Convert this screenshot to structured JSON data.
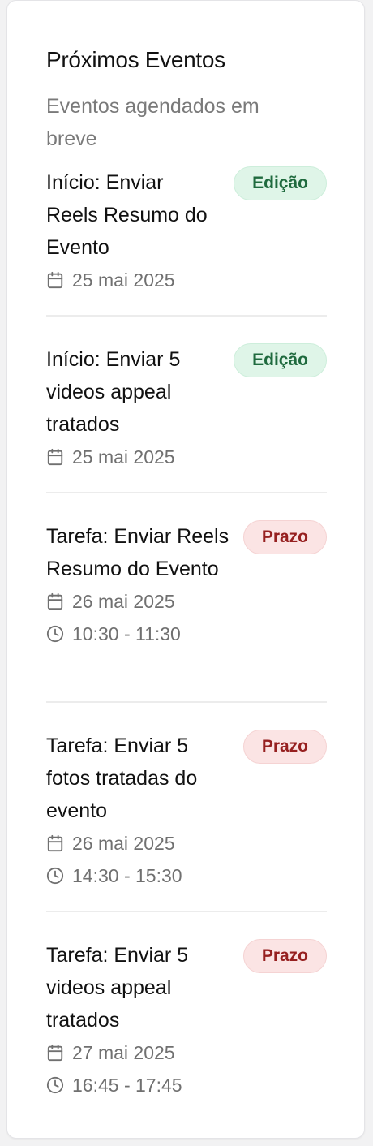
{
  "header": {
    "title": "Próximos Eventos",
    "subtitle": "Eventos agendados em breve"
  },
  "colors": {
    "edicao_bg": "#dff5e8",
    "edicao_text": "#1f6a3e",
    "prazo_bg": "#fbe4e4",
    "prazo_text": "#962020"
  },
  "events": [
    {
      "title": "Início: Enviar Reels Resumo do Evento",
      "badge": "Edição",
      "date": "25 mai 2025",
      "icons": [
        "calendar-icon"
      ]
    },
    {
      "title": "Início: Enviar 5 videos appeal tratados",
      "badge": "Edição",
      "date": "25 mai 2025",
      "icons": [
        "calendar-icon"
      ]
    },
    {
      "title": "Tarefa: Enviar Reels Resumo do Evento",
      "badge": "Prazo",
      "date": "26 mai 2025",
      "time": "10:30 - 11:30",
      "icons": [
        "calendar-icon",
        "clock-icon"
      ]
    },
    {
      "title": "Tarefa: Enviar 5 fotos tratadas do evento",
      "badge": "Prazo",
      "date": "26 mai 2025",
      "time": "14:30 - 15:30",
      "icons": [
        "calendar-icon",
        "clock-icon"
      ]
    },
    {
      "title": "Tarefa: Enviar 5 videos appeal tratados",
      "badge": "Prazo",
      "date": "27 mai 2025",
      "time": "16:45 - 17:45",
      "icons": [
        "calendar-icon",
        "clock-icon"
      ]
    }
  ]
}
